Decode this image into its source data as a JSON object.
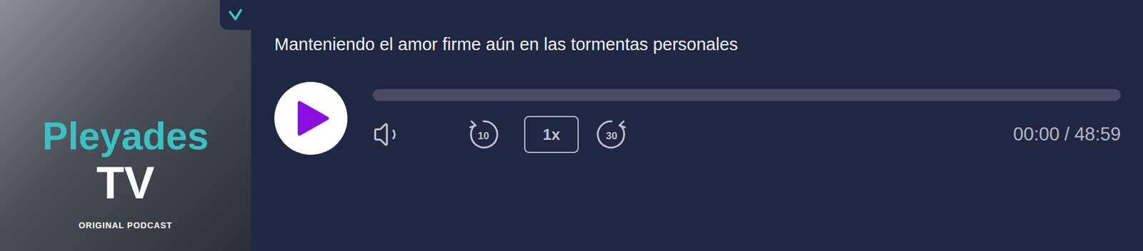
{
  "episode": {
    "title": "Manteniendo el amor firme aún en las tormentas personales"
  },
  "cover": {
    "brand": "Pleyades",
    "sub": "TV",
    "tagline": "ORIGINAL PODCAST"
  },
  "player": {
    "playing": false,
    "level": 0,
    "rewind": "10",
    "speed": "1x",
    "forward": "30",
    "current": "00:00",
    "separator": "/",
    "duration": "48:59",
    "muted": false
  }
}
